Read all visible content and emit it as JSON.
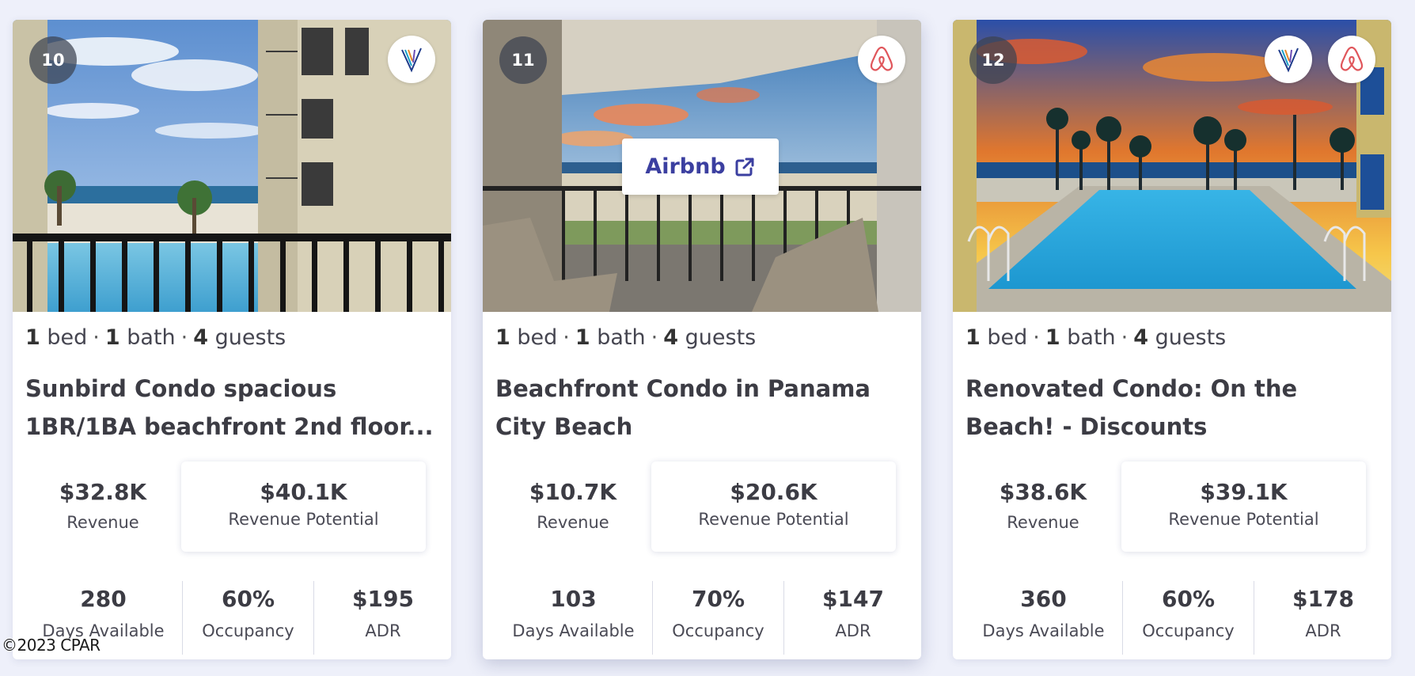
{
  "listings": [
    {
      "rank": "10",
      "specs": {
        "beds": "1",
        "bed_label": "bed",
        "baths": "1",
        "bath_label": "bath",
        "guests": "4",
        "guest_label": "guests",
        "separator": "·"
      },
      "title": "Sunbird Condo spacious 1BR/1BA beachfront 2nd floor...",
      "revenue": {
        "value": "$32.8K",
        "label": "Revenue"
      },
      "revenue_potential": {
        "value": "$40.1K",
        "label": "Revenue Potential"
      },
      "stats": [
        {
          "value": "280",
          "label": "Days Available"
        },
        {
          "value": "60%",
          "label": "Occupancy"
        },
        {
          "value": "$195",
          "label": "ADR"
        }
      ],
      "platforms": [
        "vrbo-icon"
      ]
    },
    {
      "rank": "11",
      "specs": {
        "beds": "1",
        "bed_label": "bed",
        "baths": "1",
        "bath_label": "bath",
        "guests": "4",
        "guest_label": "guests",
        "separator": "·"
      },
      "title": "Beachfront Condo in Panama City Beach",
      "overlay_button": "Airbnb",
      "revenue": {
        "value": "$10.7K",
        "label": "Revenue"
      },
      "revenue_potential": {
        "value": "$20.6K",
        "label": "Revenue Potential"
      },
      "stats": [
        {
          "value": "103",
          "label": "Days Available"
        },
        {
          "value": "70%",
          "label": "Occupancy"
        },
        {
          "value": "$147",
          "label": "ADR"
        }
      ],
      "platforms": [
        "airbnb-icon"
      ]
    },
    {
      "rank": "12",
      "specs": {
        "beds": "1",
        "bed_label": "bed",
        "baths": "1",
        "bath_label": "bath",
        "guests": "4",
        "guest_label": "guests",
        "separator": "·"
      },
      "title": "Renovated Condo: On the Beach! - Discounts",
      "revenue": {
        "value": "$38.6K",
        "label": "Revenue"
      },
      "revenue_potential": {
        "value": "$39.1K",
        "label": "Revenue Potential"
      },
      "stats": [
        {
          "value": "360",
          "label": "Days Available"
        },
        {
          "value": "60%",
          "label": "Occupancy"
        },
        {
          "value": "$178",
          "label": "ADR"
        }
      ],
      "platforms": [
        "vrbo-icon",
        "airbnb-icon"
      ]
    }
  ],
  "watermark": "©2023 CPAR",
  "colors": {
    "background": "#eef0fa",
    "card": "#ffffff",
    "airbnb": "#e0565b",
    "link": "#3b3fa0",
    "vrbo": "#1e3a8a"
  }
}
